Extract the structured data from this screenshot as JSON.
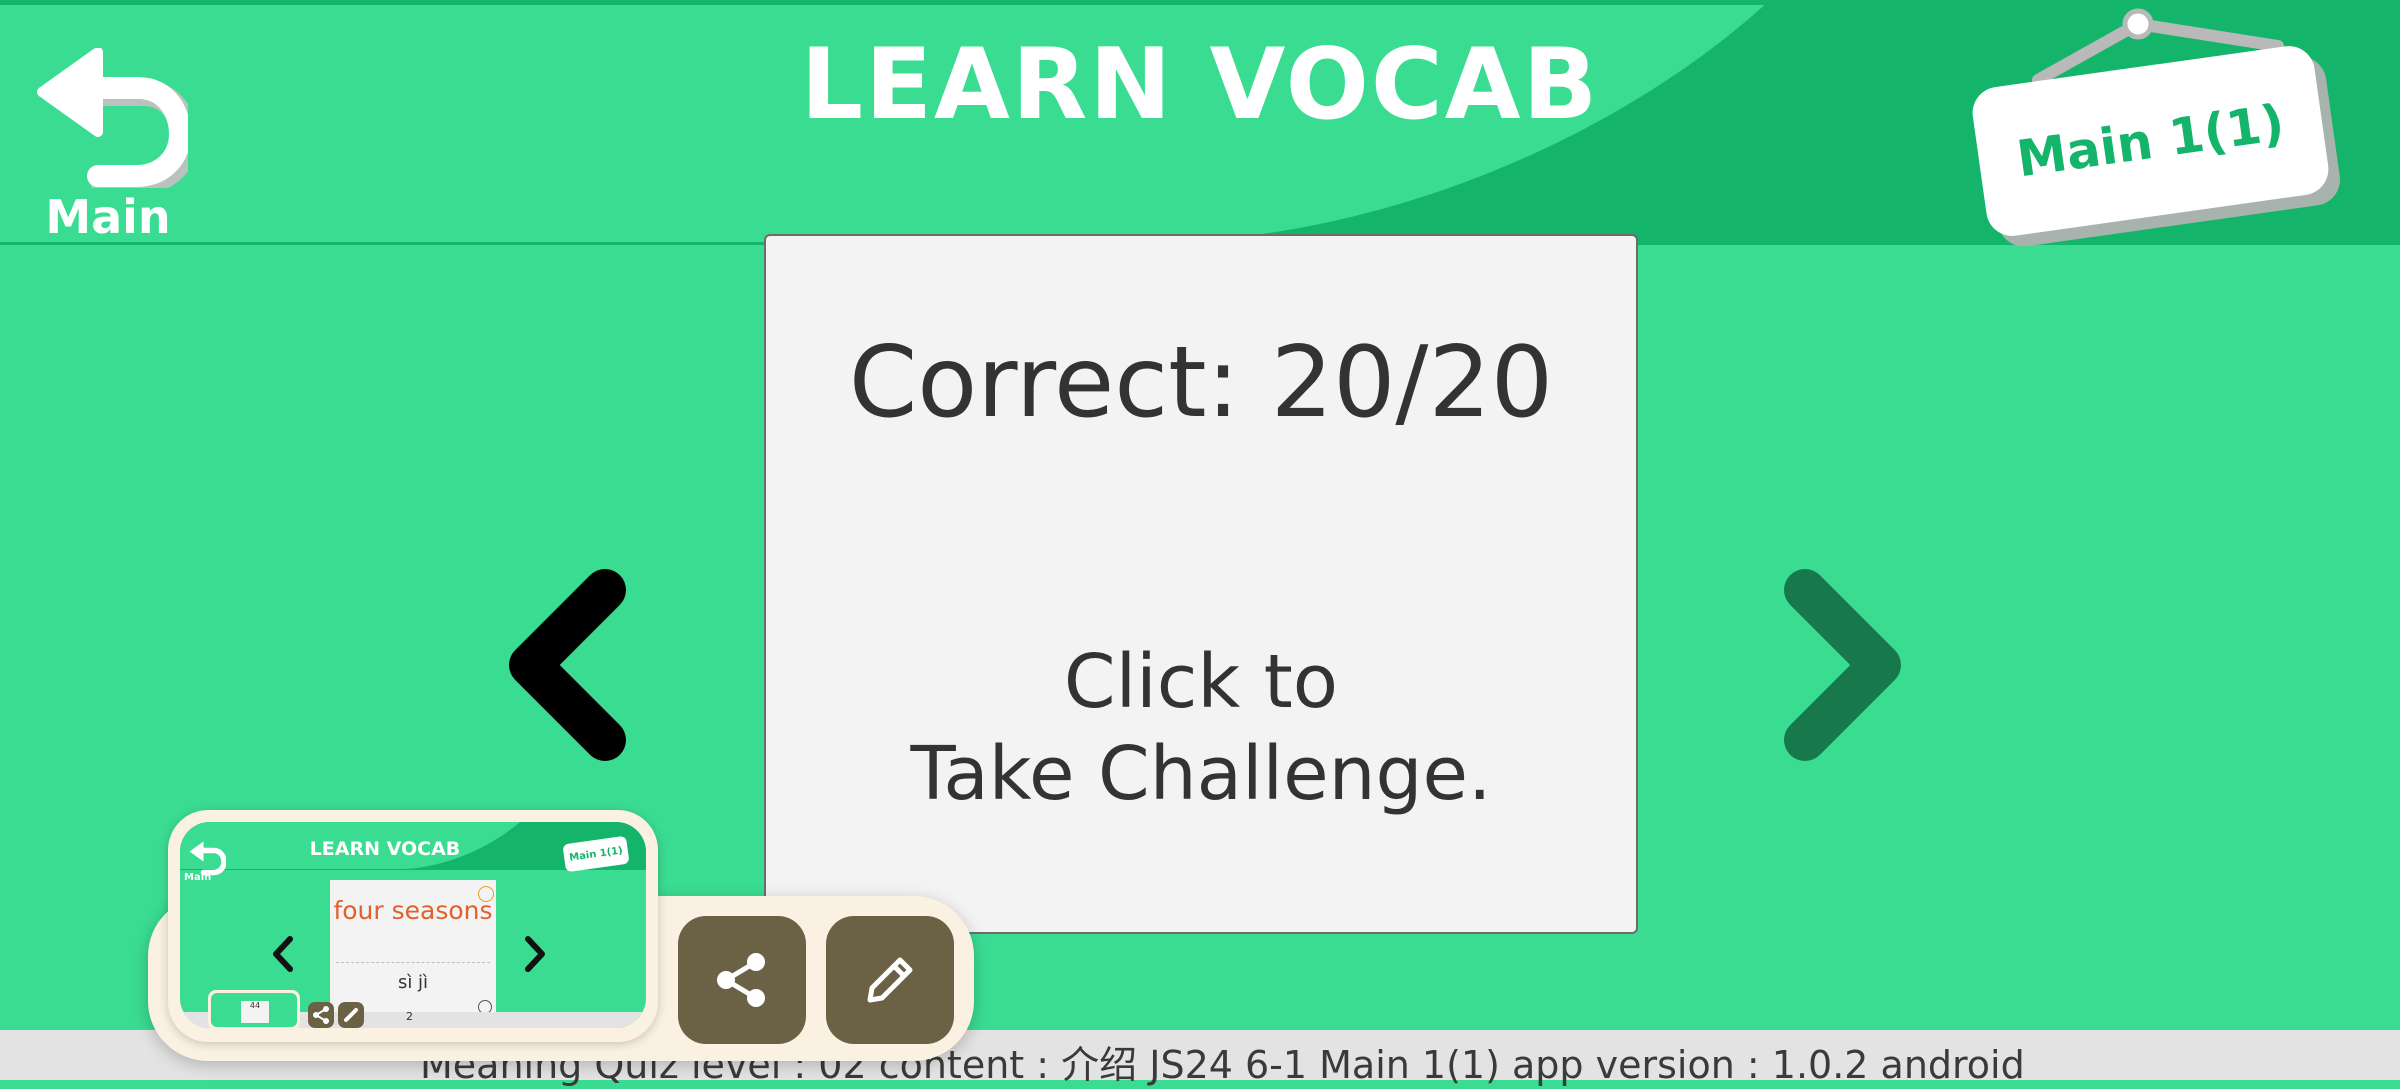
{
  "header": {
    "title": "LEARN VOCAB",
    "back_label": "Main",
    "level_badge": "Main 1(1)"
  },
  "card": {
    "score": "Correct: 20/20",
    "cta_line1": "Click to",
    "cta_line2": "Take Challenge."
  },
  "footer": {
    "text": "Meaning Quiz  level : 02   content : 介绍 JS24 6-1   Main 1(1)   app version : 1.0.2 android"
  },
  "preview": {
    "title": "LEARN VOCAB",
    "back_label": "Main",
    "badge": "Main 1(1)",
    "word": "four seasons",
    "pinyin": "sì jì",
    "page": "2",
    "mini_card": "44"
  },
  "colors": {
    "background": "#3ADC92",
    "header_dark": "#14B46B",
    "card": "#F3F3F3",
    "action_button": "#6B6245",
    "word": "#E0612B"
  },
  "icons": {
    "back": "undo-arrow-icon",
    "prev": "chevron-left-icon",
    "next": "chevron-right-icon",
    "share": "share-icon",
    "edit": "pencil-icon"
  }
}
